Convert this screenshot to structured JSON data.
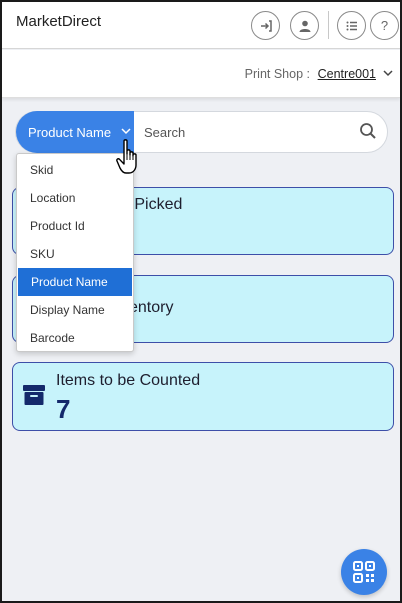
{
  "header": {
    "title": "MarketDirect",
    "icons": [
      "login-icon",
      "user-icon",
      "list-icon",
      "help-icon"
    ],
    "help_glyph": "?"
  },
  "print_shop": {
    "label": "Print Shop :",
    "value": "Centre001"
  },
  "search": {
    "field_selected": "Product Name",
    "placeholder": "Search",
    "field_options": [
      "Skid",
      "Location",
      "Product Id",
      "SKU",
      "Product Name",
      "Display Name",
      "Barcode"
    ],
    "selected_index": 4
  },
  "cards": [
    {
      "title_visible": "e Picked"
    },
    {
      "title_visible": "ventory"
    },
    {
      "title": "Items to be Counted",
      "count": "7",
      "icon": "archive-box-icon"
    }
  ],
  "colors": {
    "accent": "#3a82e6",
    "card_bg": "#c7f3fb",
    "card_border": "#3d4fa8",
    "count_text": "#14296b",
    "selected_option": "#1f6fd6"
  },
  "fab": {
    "icon": "qr-code-icon"
  }
}
